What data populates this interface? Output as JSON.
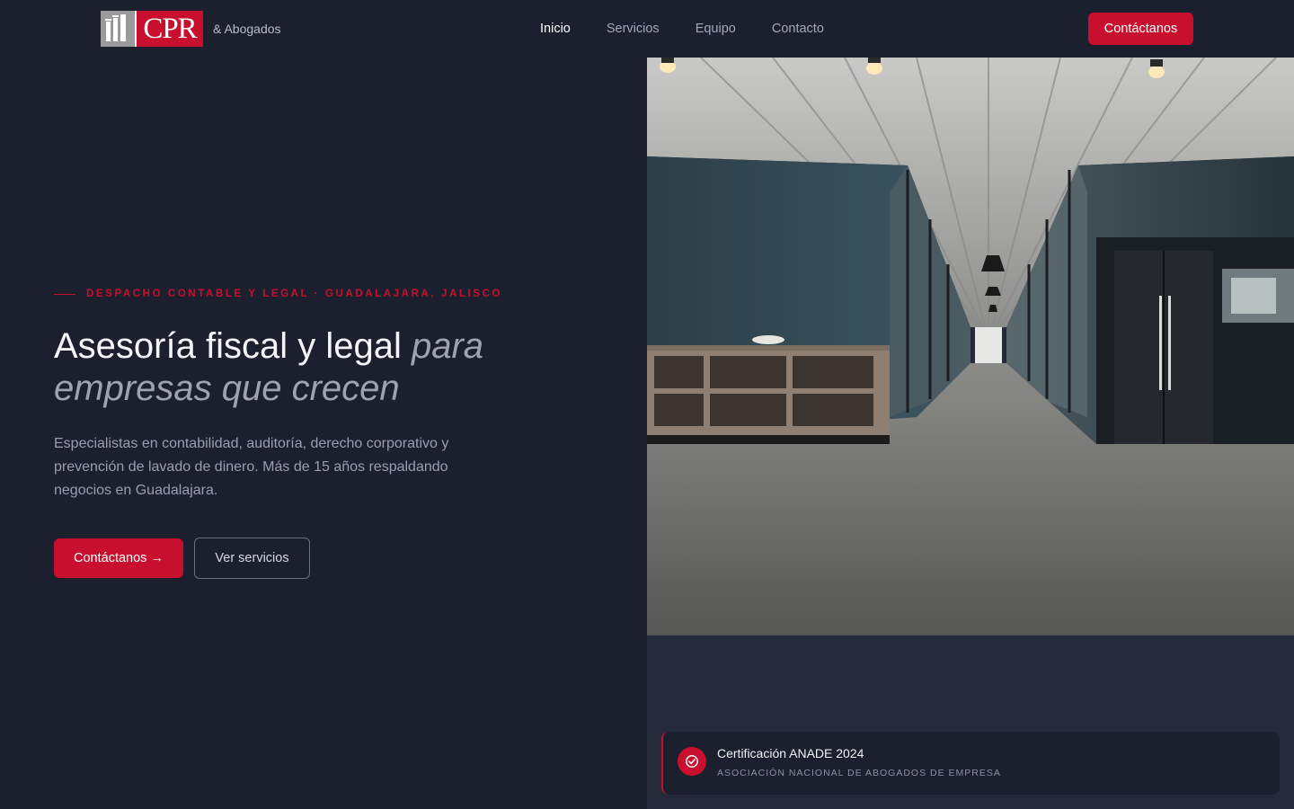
{
  "brand": {
    "mark_text": "CPR",
    "suffix": "& Abogados"
  },
  "nav": {
    "links": [
      "Inicio",
      "Servicios",
      "Equipo",
      "Contacto"
    ],
    "active": "Inicio",
    "cta_label": "Contáctanos"
  },
  "hero": {
    "eyebrow": "DESPACHO CONTABLE Y LEGAL · GUADALAJARA, JALISCO",
    "headline_plain": "Asesoría fiscal y legal ",
    "headline_italic_1": "para",
    "headline_italic_2": "empresas que crecen",
    "lead": "Especialistas en contabilidad, auditoría, derecho corporativo y prevención de lavado de dinero. Más de 15 años respaldando negocios en Guadalajara.",
    "primary_button": "Contáctanos →",
    "secondary_button": "Ver servicios"
  },
  "certification": {
    "title": "Certificación ANADE 2024",
    "subtitle": "ASOCIACIÓN NACIONAL DE ABOGADOS DE EMPRESA",
    "icon": "check-circle-icon"
  },
  "colors": {
    "background": "#1c1f2e",
    "accent": "#c8102e",
    "panel": "#252a3b",
    "muted_text": "#9a9eae"
  }
}
